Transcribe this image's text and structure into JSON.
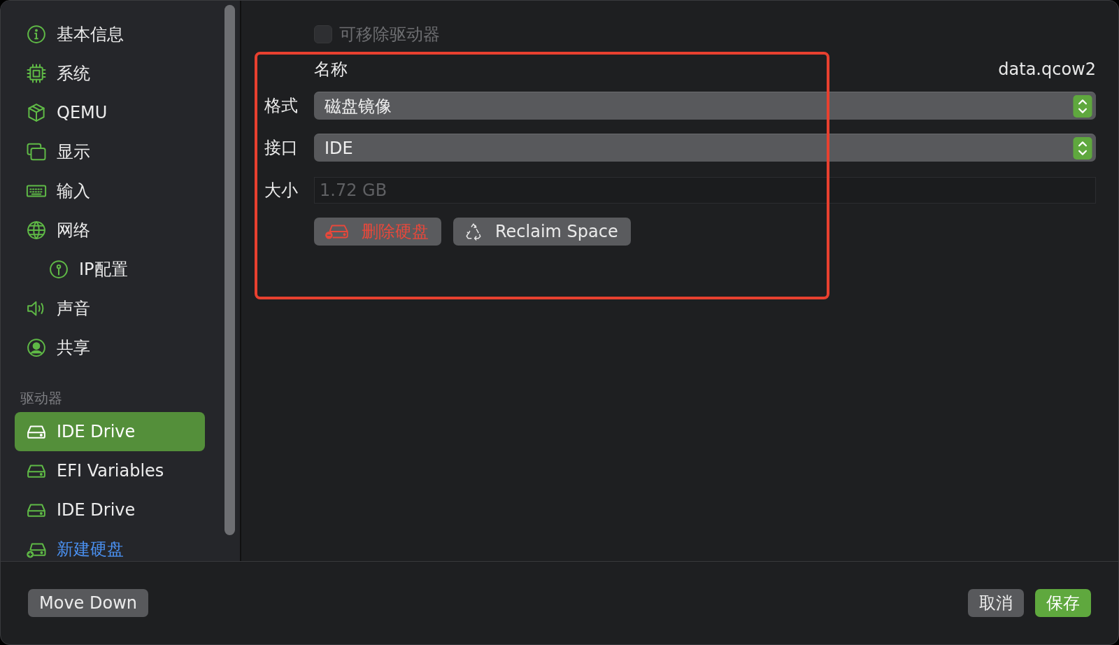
{
  "sidebar": {
    "items": [
      {
        "label": "基本信息"
      },
      {
        "label": "系统"
      },
      {
        "label": "QEMU"
      },
      {
        "label": "显示"
      },
      {
        "label": "输入"
      },
      {
        "label": "网络",
        "children": [
          {
            "label": "IP配置"
          }
        ]
      },
      {
        "label": "声音"
      },
      {
        "label": "共享"
      }
    ],
    "section_title": "驱动器",
    "drives": [
      {
        "label": "IDE Drive",
        "selected": true
      },
      {
        "label": "EFI Variables",
        "selected": false
      },
      {
        "label": "IDE Drive",
        "selected": false
      }
    ],
    "new_drive": "新建硬盘"
  },
  "removable": {
    "label": "可移除驱动器",
    "checked": false,
    "disabled": true
  },
  "highlight": true,
  "fields": [
    {
      "kind": "text",
      "label": "名称",
      "value": "data.qcow2"
    },
    {
      "kind": "select",
      "label": "格式",
      "value": "磁盘镜像"
    },
    {
      "kind": "select",
      "label": "接口",
      "value": "IDE"
    },
    {
      "kind": "readonly",
      "label": "大小",
      "value": "1.72 GB"
    }
  ],
  "actions": [
    {
      "kind": "delete",
      "label": "删除硬盘"
    },
    {
      "kind": "reclaim",
      "label": "Reclaim Space"
    }
  ],
  "footer": {
    "move": "Move Down",
    "cancel": "取消",
    "save": "保存"
  }
}
